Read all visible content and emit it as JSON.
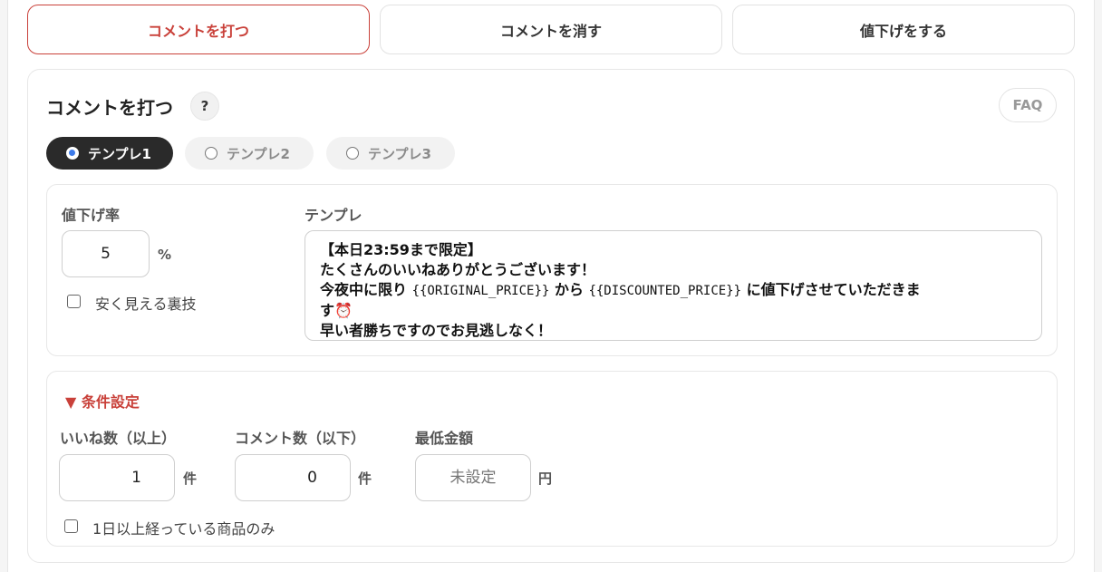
{
  "tabs": [
    {
      "label": "コメントを打つ",
      "active": true
    },
    {
      "label": "コメントを消す",
      "active": false
    },
    {
      "label": "値下げをする",
      "active": false
    }
  ],
  "card": {
    "title": "コメントを打つ",
    "help": "?",
    "faq": "FAQ"
  },
  "templates": [
    {
      "label": "テンプレ1",
      "active": true
    },
    {
      "label": "テンプレ2",
      "active": false
    },
    {
      "label": "テンプレ3",
      "active": false
    }
  ],
  "discount": {
    "label": "値下げ率",
    "value": "5",
    "unit": "%",
    "trick_label": "安く見える裏技"
  },
  "template_text": {
    "label": "テンプレ",
    "line1": "【本日23:59まで限定】",
    "line2": "たくさんのいいねありがとうございます！",
    "line3_a": "今夜中に限り ",
    "line3_b": "{{ORIGINAL_PRICE}}",
    "line3_c": " から ",
    "line3_d": "{{DISCOUNTED_PRICE}}",
    "line3_e": " に値下げさせていただきま",
    "line4": "す⏰",
    "line5": "早い者勝ちですのでお見逃しなく！"
  },
  "conditions": {
    "title": "▼ 条件設定",
    "likes_label": "いいね数（以上）",
    "likes_value": "1",
    "likes_unit": "件",
    "comments_label": "コメント数（以下）",
    "comments_value": "0",
    "comments_unit": "件",
    "min_price_label": "最低金額",
    "min_price_placeholder": "未設定",
    "min_price_unit": "円",
    "age_label": "1日以上経っている商品のみ"
  },
  "colors": {
    "accent": "#c9413a",
    "active_pill": "#2a2a2a",
    "radio_dot": "#3d7bea"
  }
}
